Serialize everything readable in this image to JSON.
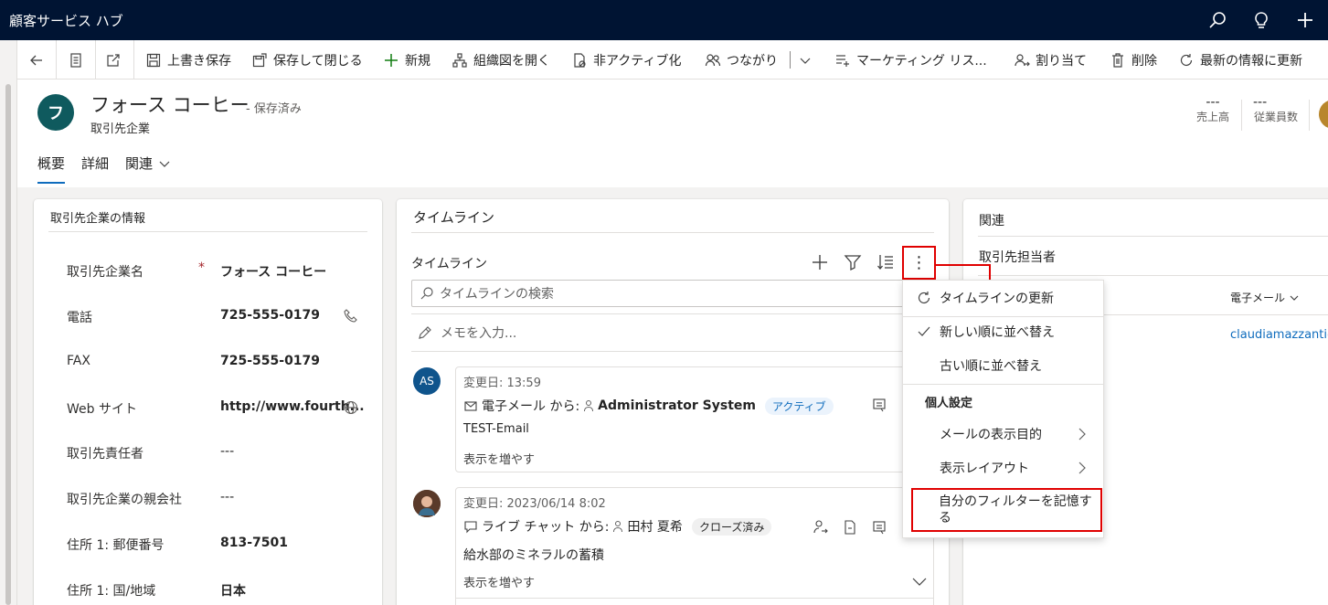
{
  "app": {
    "title": "顧客サービス ハブ"
  },
  "topbar_icons": [
    "search-icon",
    "lightbulb-icon",
    "plus-icon"
  ],
  "commands": {
    "save": "上書き保存",
    "save_close": "保存して閉じる",
    "new": "新規",
    "org_chart": "組織図を開く",
    "deactivate": "非アクティブ化",
    "connect": "つながり",
    "marketing_list": "マーケティング リス...",
    "assign": "割り当て",
    "delete": "削除",
    "refresh": "最新の情報に更新"
  },
  "record": {
    "avatar_letter": "フ",
    "name": "フォース コーヒー",
    "status": "- 保存済み",
    "type": "取引先企業",
    "header_fields": [
      {
        "value": "---",
        "label": "売上高"
      },
      {
        "value": "---",
        "label": "従業員数"
      }
    ]
  },
  "tabs": [
    {
      "label": "概要",
      "active": true
    },
    {
      "label": "詳細",
      "active": false
    },
    {
      "label": "関連",
      "active": false
    }
  ],
  "account_info": {
    "title": "取引先企業の情報",
    "fields": [
      {
        "label": "取引先企業名",
        "required": "*",
        "value": "フォース コーヒー"
      },
      {
        "label": "電話",
        "value": "725-555-0179"
      },
      {
        "label": "FAX",
        "value": "725-555-0179"
      },
      {
        "label": "Web サイト",
        "value": "http://www.fourth..."
      },
      {
        "label": "取引先責任者",
        "value": "---"
      },
      {
        "label": "取引先企業の親会社",
        "value": "---"
      },
      {
        "label": "住所 1: 郵便番号",
        "value": "813-7501"
      },
      {
        "label": "住所 1: 国/地域",
        "value": "日本"
      }
    ]
  },
  "timeline": {
    "card_title": "タイムライン",
    "section_title": "タイムライン",
    "search_placeholder": "タイムラインの検索",
    "note_placeholder": "メモを入力...",
    "more_glyph": "⋮",
    "entries": [
      {
        "avatar": "AS",
        "avatar_color": "#0f548c",
        "date": "変更日: 13:59",
        "type": "電子メール から:",
        "person": "Administrator System",
        "badge": "アクティブ",
        "body": "TEST-Email",
        "more": "表示を増やす"
      },
      {
        "avatar_color": "#6b4a3a",
        "date": "変更日: 2023/06/14 8:02",
        "type": "ライブ チャット から:",
        "person": "田村 夏希",
        "badge": "クローズ済み",
        "body": "給水部のミネラルの蓄積",
        "more": "表示を増やす"
      }
    ]
  },
  "related": {
    "title": "関連",
    "contacts_label": "取引先担当者",
    "email_header": "電子メール",
    "email_value": "claudiamazzanti@"
  },
  "context_menu": {
    "refresh": "タイムラインの更新",
    "sort_newest": "新しい順に並べ替え",
    "sort_oldest": "古い順に並べ替え",
    "personal_settings": "個人設定",
    "email_purpose": "メールの表示目的",
    "display_layout": "表示レイアウト",
    "remember_filters": "自分のフィルターを記憶する"
  },
  "colors": {
    "topbar": "#001433",
    "accent": "#0f6cbd",
    "highlight": "#e00000",
    "avatar": "#0f5a5e"
  }
}
